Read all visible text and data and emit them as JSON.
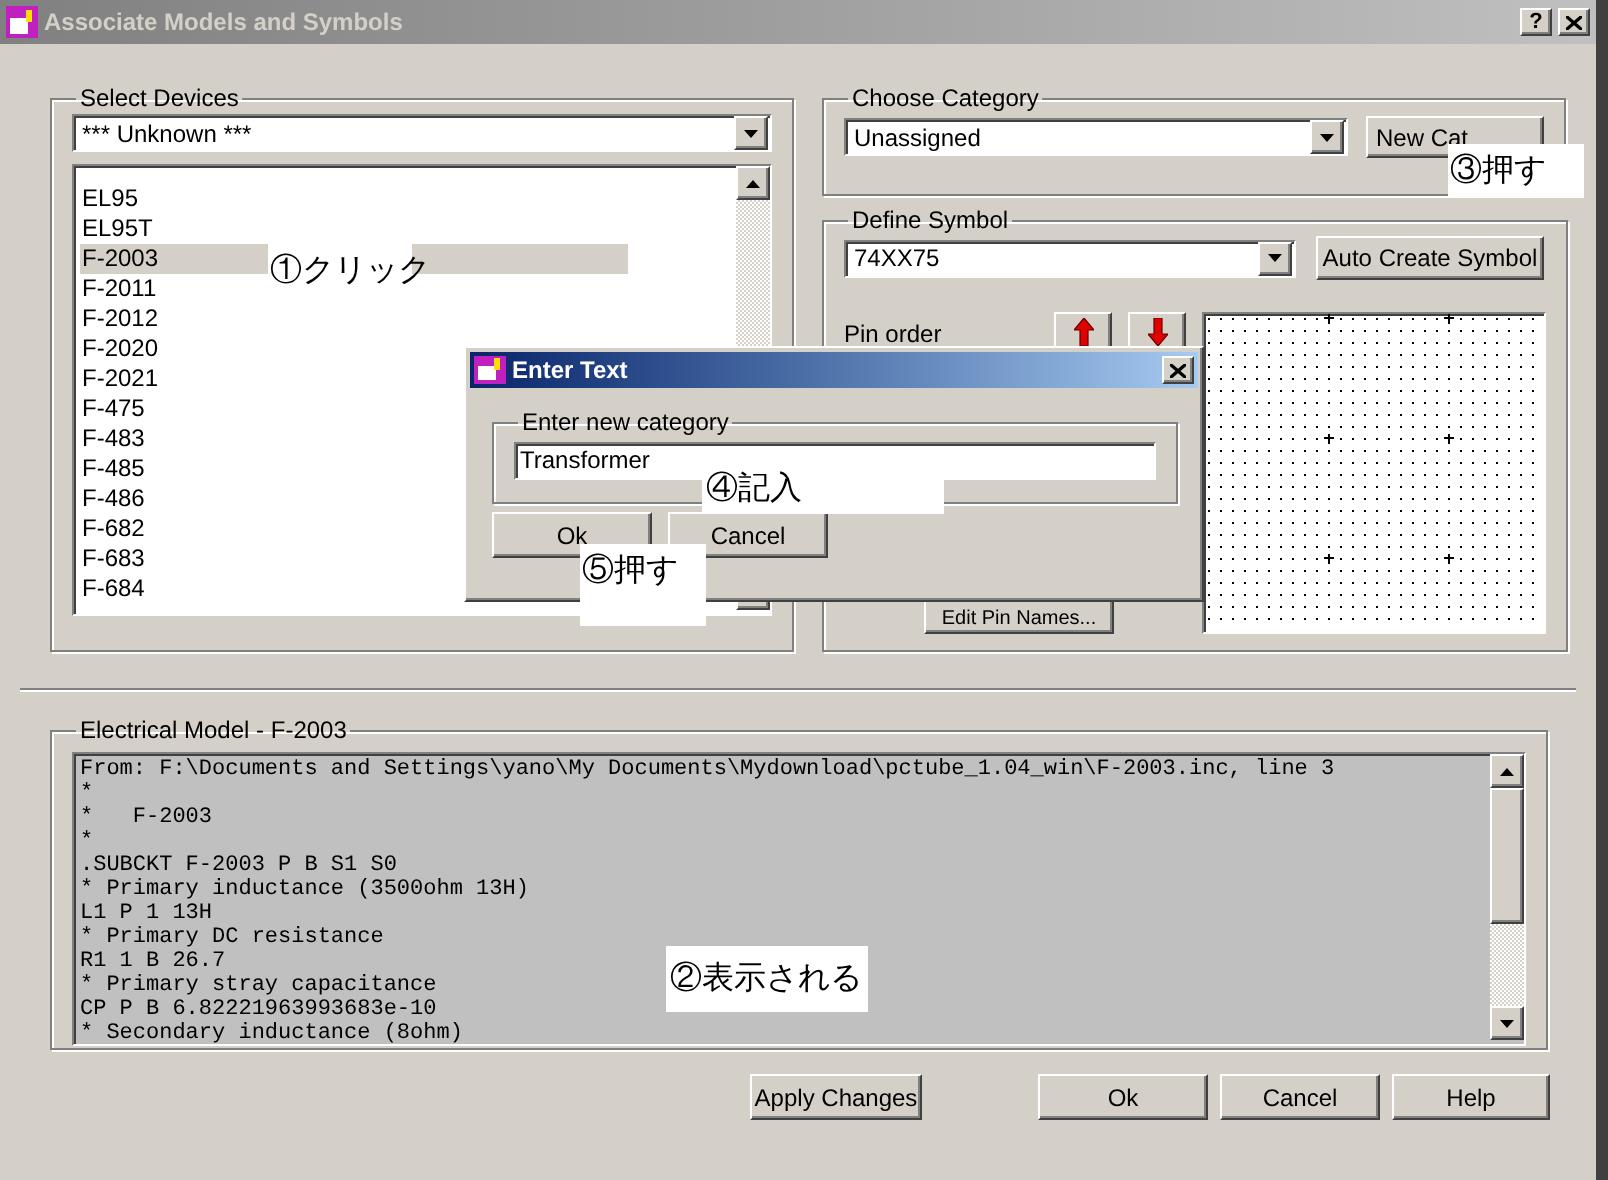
{
  "window": {
    "title": "Associate Models and Symbols",
    "help": "?"
  },
  "select_devices": {
    "label": "Select Devices",
    "combo_value": "*** Unknown ***",
    "items": [
      {
        "label": "EL95",
        "selected": false
      },
      {
        "label": "EL95T",
        "selected": false
      },
      {
        "label": "F-2003",
        "selected": true
      },
      {
        "label": "F-2011",
        "selected": false
      },
      {
        "label": "F-2012",
        "selected": false
      },
      {
        "label": "F-2020",
        "selected": false
      },
      {
        "label": "F-2021",
        "selected": false
      },
      {
        "label": "F-475",
        "selected": false
      },
      {
        "label": "F-483",
        "selected": false
      },
      {
        "label": "F-485",
        "selected": false
      },
      {
        "label": "F-486",
        "selected": false
      },
      {
        "label": "F-682",
        "selected": false
      },
      {
        "label": "F-683",
        "selected": false
      },
      {
        "label": "F-684",
        "selected": false
      }
    ]
  },
  "choose_category": {
    "label": "Choose Category",
    "combo_value": "Unassigned",
    "button": {
      "label": "New Cat"
    }
  },
  "define_symbol": {
    "label": "Define Symbol",
    "combo_value": "74XX75",
    "auto_button": {
      "label": "Auto Create Symbol"
    },
    "pin_order": {
      "label": "Pin order"
    },
    "edit_button": {
      "label": "Edit Pin Names..."
    }
  },
  "electrical_model": {
    "label": "Electrical Model - F-2003",
    "lines": [
      "From: F:\\Documents and Settings\\yano\\My Documents\\Mydownload\\pctube_1.04_win\\F-2003.inc, line 3",
      "*",
      "*   F-2003",
      "*",
      ".SUBCKT F-2003 P B S1 S0",
      "* Primary inductance (3500ohm 13H)",
      "L1 P 1 13H",
      "* Primary DC resistance",
      "R1 1 B 26.7",
      "* Primary stray capacitance",
      "CP P B 6.82221963993683e-10",
      "* Secondary inductance (8ohm)"
    ]
  },
  "buttons": [
    {
      "label": "Apply Changes"
    },
    {
      "label": "Ok"
    },
    {
      "label": "Cancel"
    },
    {
      "label": "Help"
    }
  ],
  "dialog": {
    "title": "Enter Text",
    "group_label": "Enter new category",
    "value": "Transformer",
    "buttons": [
      {
        "label": "Ok"
      },
      {
        "label": "Cancel"
      }
    ]
  },
  "annotations": [
    {
      "text": "①クリック",
      "boxed": false
    },
    {
      "text": "②表示される",
      "boxed": true
    },
    {
      "text": "③押す",
      "boxed": true
    },
    {
      "text": "④記入",
      "boxed": true
    },
    {
      "text": "⑤押す",
      "boxed": true
    }
  ]
}
